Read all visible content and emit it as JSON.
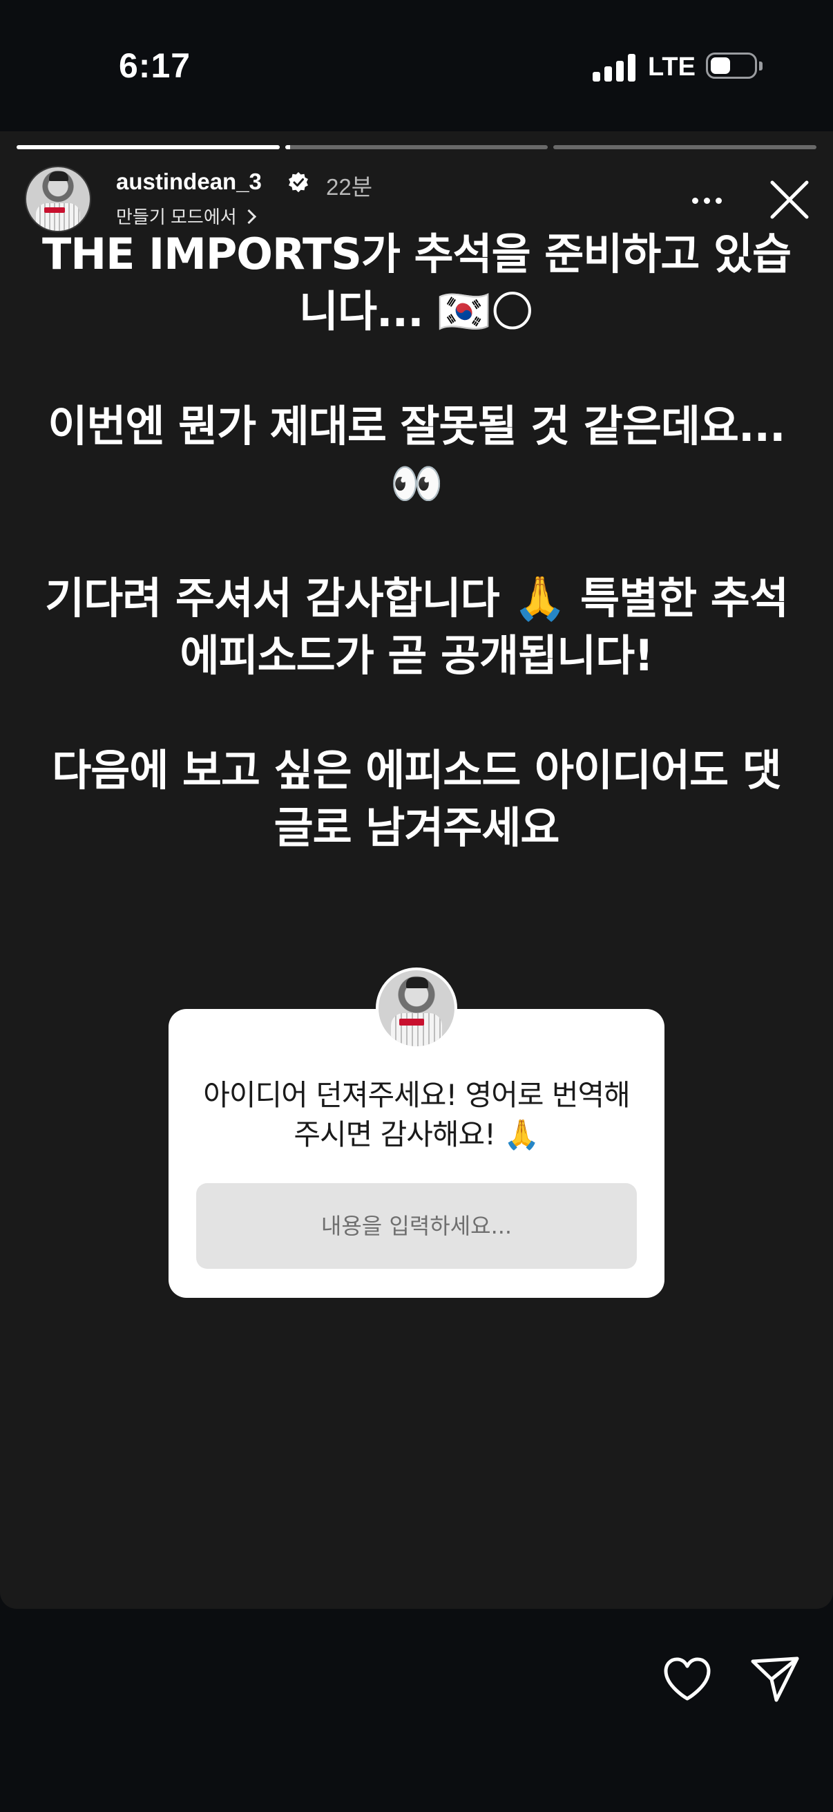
{
  "status_bar": {
    "time": "6:17",
    "network": "LTE"
  },
  "story": {
    "progress": [
      1.0,
      0.02,
      0.0
    ],
    "username": "austindean_3",
    "time_ago": "22분",
    "create_mode_label": "만들기 모드에서",
    "paragraphs": [
      "THE IMPORTS가 추석을 준비하고 있습니다... 🇰🇷🌕",
      "이번엔 뭔가 제대로 잘못될 것 같은데요... 👀",
      "기다려 주셔서 감사합니다 🙏 특별한 추석 에피소드가 곧 공개됩니다!",
      "다음에 보고 싶은 에피소드 아이디어도 댓글로 남겨주세요"
    ]
  },
  "question_sticker": {
    "prompt": "아이디어 던져주세요! 영어로 번역해 주시면 감사해요! 🙏",
    "placeholder": "내용을 입력하세요..."
  },
  "icons": {
    "verified": "verified-badge-icon",
    "more": "more-options-icon",
    "close": "close-icon",
    "like": "heart-icon",
    "share": "send-icon"
  },
  "colors": {
    "background": "#0b0d10",
    "story_background": "#1a1a1a",
    "card": "#ffffff",
    "input": "#e3e3e3"
  }
}
